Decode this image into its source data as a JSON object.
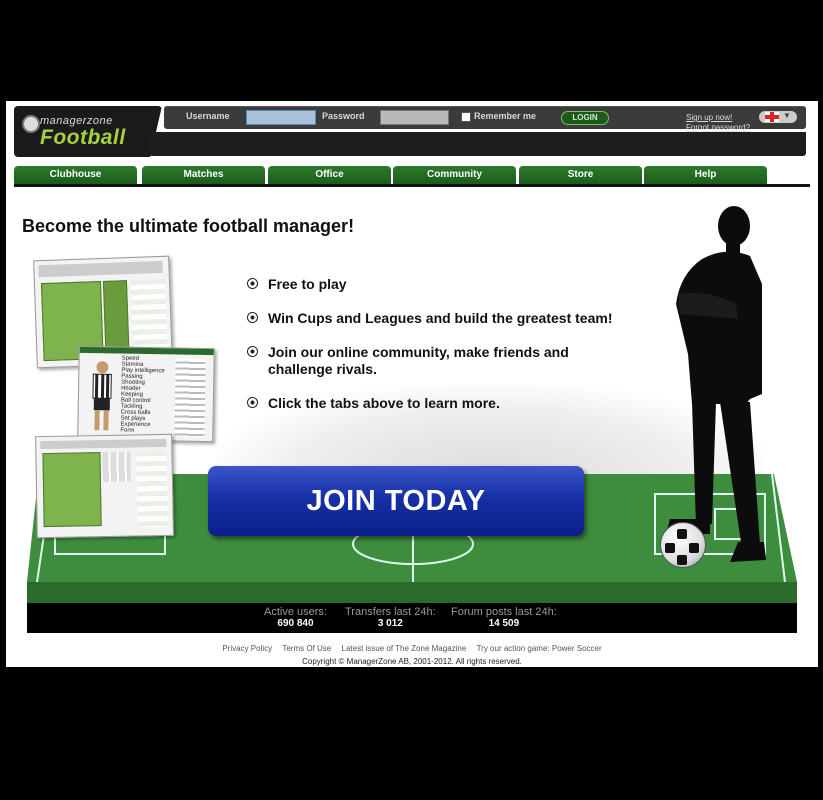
{
  "header": {
    "logo_top": "managerzone",
    "logo_main": "Football",
    "username_label": "Username",
    "password_label": "Password",
    "remember_label": "Remember me",
    "login_label": "LOGIN",
    "signup_link": "Sign up now!",
    "forgot_link": "Forgot password?"
  },
  "tabs": [
    "Clubhouse",
    "Matches",
    "Office",
    "Community",
    "Store",
    "Help"
  ],
  "main": {
    "headline": "Become the ultimate football manager!",
    "features": [
      "Free to play",
      "Win Cups and Leagues and build the greatest team!",
      "Join our online community, make friends and challenge rivals.",
      "Click the tabs above to learn more."
    ],
    "join_label": "JOIN TODAY"
  },
  "skills": [
    "Speed",
    "Stamina",
    "Play intelligence",
    "Passing",
    "Shooting",
    "Header",
    "Keeping",
    "Ball control",
    "Tackling",
    "Cross balls",
    "Set plays",
    "Experience",
    "Form"
  ],
  "stats": {
    "users_label": "Active users:",
    "users_value": "690 840",
    "transfers_label": "Transfers last 24h:",
    "transfers_value": "3 012",
    "forum_label": "Forum posts last 24h:",
    "forum_value": "14 509"
  },
  "footer": {
    "links": [
      "Privacy Policy",
      "Terms Of Use",
      "Latest issue of The Zone Magazine",
      "Try our action game: Power Soccer"
    ],
    "copyright": "Copyright © ManagerZone AB, 2001-2012. All rights reserved."
  }
}
